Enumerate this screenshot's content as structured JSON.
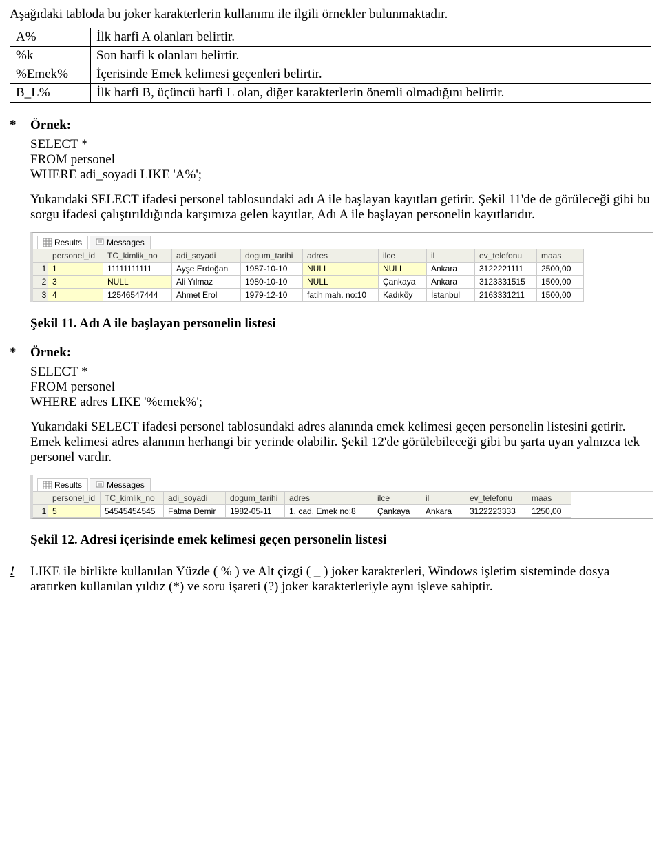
{
  "intro": "Aşağıdaki tabloda bu joker karakterlerin kullanımı ile ilgili örnekler bulunmaktadır.",
  "jokerTable": [
    {
      "pattern": "A%",
      "desc": "İlk harfi A olanları belirtir."
    },
    {
      "pattern": "%k",
      "desc": "Son harfi k olanları belirtir."
    },
    {
      "pattern": "%Emek%",
      "desc": "İçerisinde Emek kelimesi geçenleri belirtir."
    },
    {
      "pattern": "B_L%",
      "desc": "İlk harfi B, üçüncü harfi L olan, diğer karakterlerin önemli olmadığını belirtir."
    }
  ],
  "ex1": {
    "bullet": "*",
    "label": "Örnek:",
    "code1": "SELECT *",
    "code2": "FROM personel",
    "code3": "WHERE adi_soyadi LIKE 'A%';",
    "para": "Yukarıdaki SELECT ifadesi personel tablosundaki adı A ile başlayan kayıtları getirir. Şekil 11'de de görüleceği gibi bu sorgu ifadesi çalıştırıldığında karşımıza gelen kayıtlar, Adı A ile başlayan personelin kayıtlarıdır.",
    "caption": "Şekil 11. Adı A ile başlayan personelin listesi"
  },
  "ex2": {
    "bullet": "*",
    "label": "Örnek:",
    "code1": "SELECT *",
    "code2": "FROM personel",
    "code3": "WHERE adres LIKE '%emek%';",
    "para": "Yukarıdaki SELECT ifadesi personel tablosundaki adres alanında emek kelimesi geçen personelin listesini getirir. Emek kelimesi adres alanının herhangi bir yerinde olabilir. Şekil 12'de görülebileceği gibi bu şarta uyan yalnızca tek personel vardır.",
    "caption": "Şekil 12. Adresi içerisinde emek kelimesi geçen personelin listesi"
  },
  "tabs": {
    "results": "Results",
    "messages": "Messages"
  },
  "grid1": {
    "headers": [
      "personel_id",
      "TC_kimlik_no",
      "adi_soyadi",
      "dogum_tarihi",
      "adres",
      "ilce",
      "il",
      "ev_telefonu",
      "maas"
    ],
    "rows": [
      [
        "1",
        "1",
        "11111111111",
        "Ayşe Erdoğan",
        "1987-10-10",
        "NULL",
        "NULL",
        "Ankara",
        "3122221111",
        "2500,00"
      ],
      [
        "2",
        "3",
        "NULL",
        "Ali Yılmaz",
        "1980-10-10",
        "NULL",
        "Çankaya",
        "Ankara",
        "3123331515",
        "1500,00"
      ],
      [
        "3",
        "4",
        "12546547444",
        "Ahmet Erol",
        "1979-12-10",
        "fatih mah. no:10",
        "Kadıköy",
        "İstanbul",
        "2163331211",
        "1500,00"
      ]
    ]
  },
  "grid2": {
    "headers": [
      "personel_id",
      "TC_kimlik_no",
      "adi_soyadi",
      "dogum_tarihi",
      "adres",
      "ilce",
      "il",
      "ev_telefonu",
      "maas"
    ],
    "rows": [
      [
        "1",
        "5",
        "54545454545",
        "Fatma Demir",
        "1982-05-11",
        "1. cad. Emek no:8",
        "Çankaya",
        "Ankara",
        "3122223333",
        "1250,00"
      ]
    ]
  },
  "note": {
    "bullet": "!",
    "text": "LIKE ile birlikte kullanılan Yüzde ( % ) ve Alt çizgi ( _ ) joker karakterleri, Windows işletim sisteminde dosya aratırken kullanılan yıldız (*) ve soru işareti (?) joker karakterleriyle aynı işleve sahiptir."
  },
  "gridCols1": "22px 80px 100px 100px 90px 110px 70px 70px 90px 68px",
  "gridCols2": "22px 76px 92px 90px 86px 128px 70px 64px 90px 64px"
}
